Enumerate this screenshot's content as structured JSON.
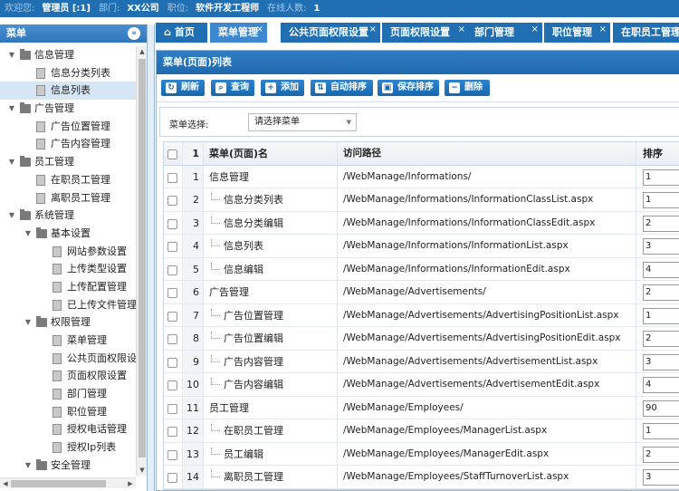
{
  "topbar": {
    "welcome_label": "欢迎您:",
    "user": "管理员 [:1]",
    "dept_label": "部门:",
    "dept": "XX公司",
    "position_label": "职位:",
    "position": "软件开发工程师",
    "online_label": "在线人数:",
    "online": "1"
  },
  "sidebar": {
    "title": "菜单",
    "collapse_icon": "double-chevron-left-icon",
    "tree": [
      {
        "label": "信息管理",
        "level": 0,
        "type": "folder",
        "expanded": true
      },
      {
        "label": "信息分类列表",
        "level": 1,
        "type": "file"
      },
      {
        "label": "信息列表",
        "level": 1,
        "type": "file",
        "selected": true
      },
      {
        "label": "广告管理",
        "level": 0,
        "type": "folder",
        "expanded": true
      },
      {
        "label": "广告位置管理",
        "level": 1,
        "type": "file"
      },
      {
        "label": "广告内容管理",
        "level": 1,
        "type": "file"
      },
      {
        "label": "员工管理",
        "level": 0,
        "type": "folder",
        "expanded": true
      },
      {
        "label": "在职员工管理",
        "level": 1,
        "type": "file"
      },
      {
        "label": "离职员工管理",
        "level": 1,
        "type": "file"
      },
      {
        "label": "系统管理",
        "level": 0,
        "type": "folder",
        "expanded": true
      },
      {
        "label": "基本设置",
        "level": 1,
        "type": "folder",
        "expanded": true
      },
      {
        "label": "网站参数设置",
        "level": 2,
        "type": "file"
      },
      {
        "label": "上传类型设置",
        "level": 2,
        "type": "file"
      },
      {
        "label": "上传配置管理",
        "level": 2,
        "type": "file"
      },
      {
        "label": "已上传文件管理",
        "level": 2,
        "type": "file"
      },
      {
        "label": "权限管理",
        "level": 1,
        "type": "folder",
        "expanded": true
      },
      {
        "label": "菜单管理",
        "level": 2,
        "type": "file"
      },
      {
        "label": "公共页面权限设置",
        "level": 2,
        "type": "file"
      },
      {
        "label": "页面权限设置",
        "level": 2,
        "type": "file"
      },
      {
        "label": "部门管理",
        "level": 2,
        "type": "file"
      },
      {
        "label": "职位管理",
        "level": 2,
        "type": "file"
      },
      {
        "label": "授权电话管理",
        "level": 2,
        "type": "file"
      },
      {
        "label": "授权Ip列表",
        "level": 2,
        "type": "file"
      },
      {
        "label": "安全管理",
        "level": 1,
        "type": "folder",
        "expanded": true
      }
    ]
  },
  "tabs": [
    {
      "label": "首页",
      "icon": "home-icon",
      "active": false,
      "closable": false
    },
    {
      "label": "菜单管理",
      "active": true,
      "closable": true
    },
    {
      "label": "公共页面权限设置",
      "active": false,
      "closable": true
    },
    {
      "label": "页面权限设置",
      "active": false,
      "closable": true
    },
    {
      "label": "部门管理",
      "active": false,
      "closable": true
    },
    {
      "label": "职位管理",
      "active": false,
      "closable": true
    },
    {
      "label": "在职员工管理",
      "active": false,
      "closable": true
    }
  ],
  "panel": {
    "title": "菜单(页面)列表",
    "toolbar": [
      {
        "label": "刷新",
        "icon": "refresh-icon"
      },
      {
        "label": "查询",
        "icon": "search-icon"
      },
      {
        "label": "添加",
        "icon": "add-icon"
      },
      {
        "label": "自动排序",
        "icon": "sort-icon"
      },
      {
        "label": "保存排序",
        "icon": "save-icon"
      },
      {
        "label": "删除",
        "icon": "delete-icon"
      }
    ],
    "filter": {
      "label": "菜单选择:",
      "value": "请选择菜单"
    }
  },
  "grid": {
    "headers": {
      "num": "1",
      "name": "菜单(页面)名",
      "path": "访问路径",
      "sort": "排序"
    },
    "rows": [
      {
        "num": "1",
        "name": "信息管理",
        "child": false,
        "path": "/WebManage/Informations/",
        "sort": "1"
      },
      {
        "num": "2",
        "name": "信息分类列表",
        "child": true,
        "path": "/WebManage/Informations/InformationClassList.aspx",
        "sort": "1"
      },
      {
        "num": "3",
        "name": "信息分类编辑",
        "child": true,
        "path": "/WebManage/Informations/InformationClassEdit.aspx",
        "sort": "2"
      },
      {
        "num": "4",
        "name": "信息列表",
        "child": true,
        "path": "/WebManage/Informations/InformationList.aspx",
        "sort": "3"
      },
      {
        "num": "5",
        "name": "信息编辑",
        "child": true,
        "path": "/WebManage/Informations/InformationEdit.aspx",
        "sort": "4"
      },
      {
        "num": "6",
        "name": "广告管理",
        "child": false,
        "path": "/WebManage/Advertisements/",
        "sort": "2"
      },
      {
        "num": "7",
        "name": "广告位置管理",
        "child": true,
        "path": "/WebManage/Advertisements/AdvertisingPositionList.aspx",
        "sort": "1"
      },
      {
        "num": "8",
        "name": "广告位置编辑",
        "child": true,
        "path": "/WebManage/Advertisements/AdvertisingPositionEdit.aspx",
        "sort": "2"
      },
      {
        "num": "9",
        "name": "广告内容管理",
        "child": true,
        "path": "/WebManage/Advertisements/AdvertisementList.aspx",
        "sort": "3"
      },
      {
        "num": "10",
        "name": "广告内容编辑",
        "child": true,
        "path": "/WebManage/Advertisements/AdvertisementEdit.aspx",
        "sort": "4"
      },
      {
        "num": "11",
        "name": "员工管理",
        "child": false,
        "path": "/WebManage/Employees/",
        "sort": "90"
      },
      {
        "num": "12",
        "name": "在职员工管理",
        "child": true,
        "path": "/WebManage/Employees/ManagerList.aspx",
        "sort": "1"
      },
      {
        "num": "13",
        "name": "员工编辑",
        "child": true,
        "path": "/WebManage/Employees/ManagerEdit.aspx",
        "sort": "2"
      },
      {
        "num": "14",
        "name": "离职员工管理",
        "child": true,
        "path": "/WebManage/Employees/StaffTurnoverList.aspx",
        "sort": "3"
      }
    ]
  }
}
